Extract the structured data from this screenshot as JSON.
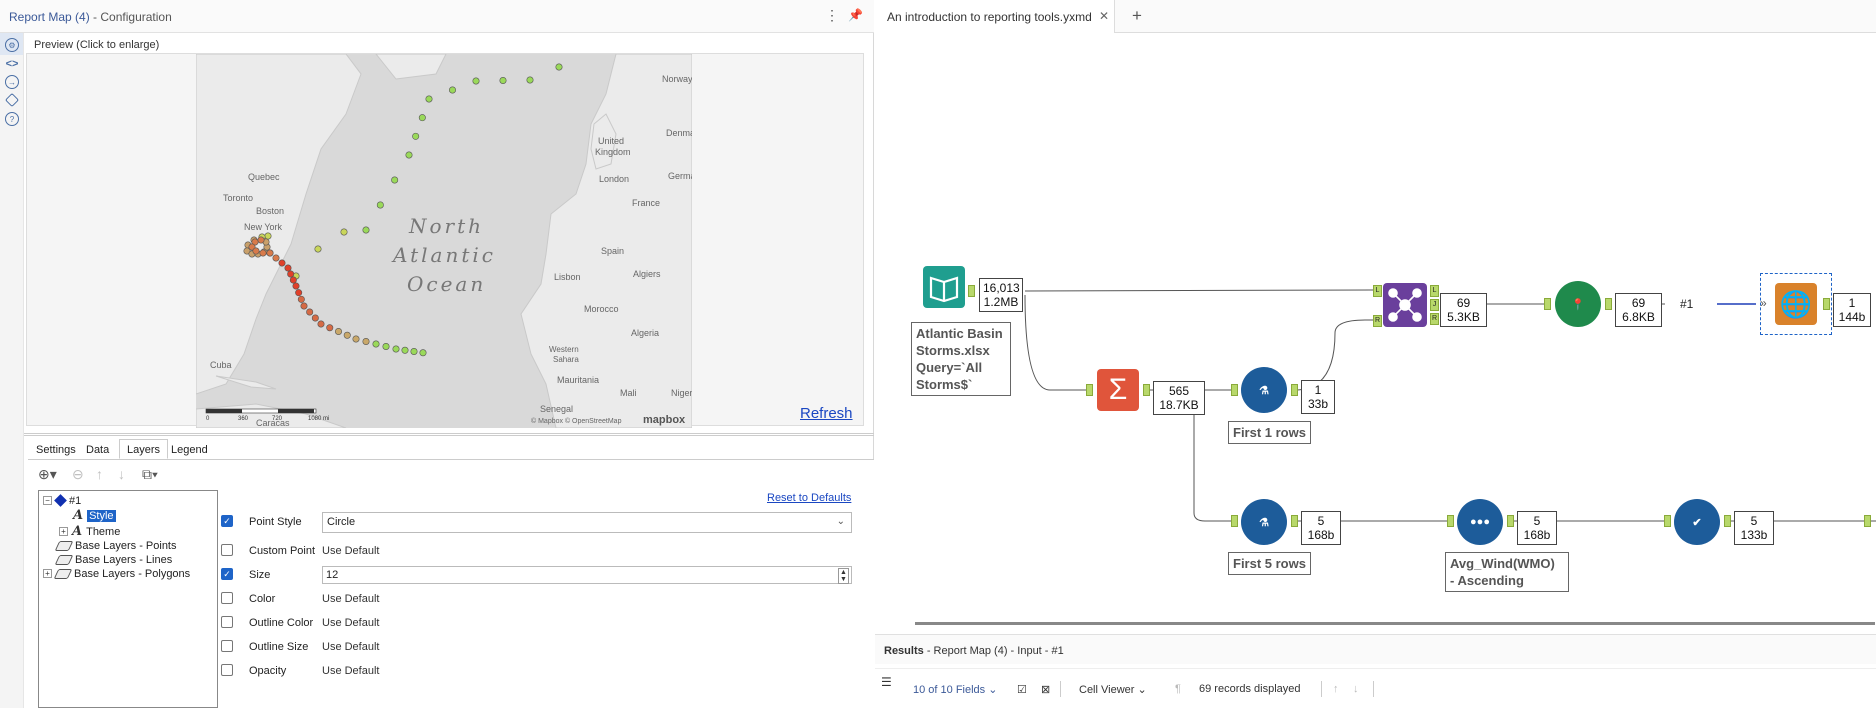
{
  "config": {
    "title": "Report Map (4)",
    "subtitle": "- Configuration",
    "preview_label": "Preview (Click to enlarge)",
    "refresh_label": "Refresh",
    "tabs": [
      "Settings",
      "Data",
      "Layers",
      "Legend"
    ],
    "active_tab": "Layers",
    "reset_label": "Reset to Defaults",
    "tree": {
      "root": "#1",
      "style": "Style",
      "theme": "Theme",
      "base_points": "Base Layers - Points",
      "base_lines": "Base Layers - Lines",
      "base_polygons": "Base Layers - Polygons"
    },
    "properties": [
      {
        "label": "Point Style",
        "checked": true,
        "value": "Circle"
      },
      {
        "label": "Custom Point",
        "checked": false,
        "value": "Use Default"
      },
      {
        "label": "Size",
        "checked": true,
        "value": "12"
      },
      {
        "label": "Color",
        "checked": false,
        "value": "Use Default"
      },
      {
        "label": "Outline Color",
        "checked": false,
        "value": "Use Default"
      },
      {
        "label": "Outline Size",
        "checked": false,
        "value": "Use Default"
      },
      {
        "label": "Opacity",
        "checked": false,
        "value": "Use Default"
      }
    ]
  },
  "map": {
    "ocean_label": [
      "North",
      "Atlantic",
      "Ocean"
    ],
    "places": [
      "Toronto",
      "Quebec",
      "Boston",
      "New York",
      "Cuba",
      "Caracas",
      "United Kingdom",
      "London",
      "France",
      "Spain",
      "Lisbon",
      "Algiers",
      "Morocco",
      "Algeria",
      "Western Sahara",
      "Mauritania",
      "Mali",
      "Niger",
      "Senegal",
      "Norway",
      "Denmark",
      "Germany"
    ],
    "scale_labels": [
      "0",
      "360",
      "720",
      "1080 mi"
    ],
    "attribution": "© Mapbox © OpenStreetMap",
    "logo": "mapbox"
  },
  "workflow": {
    "doc_tab": "An introduction to reporting tools.yxmd",
    "input_counts": [
      "16,013",
      "1.2MB"
    ],
    "input_annotation": [
      "Atlantic Basin",
      "Storms.xlsx",
      "Query=`All",
      "Storms$`"
    ],
    "summarize_counts": [
      "565",
      "18.7KB"
    ],
    "sample1_counts": [
      "1",
      "33b"
    ],
    "sample1_label": "First 1 rows",
    "join_anchors": [
      "L",
      "J",
      "R"
    ],
    "join_in_anchors": [
      "L",
      "R"
    ],
    "join_counts": [
      "69",
      "5.3KB"
    ],
    "map_counts": [
      "69",
      "6.8KB"
    ],
    "map_link_label": "#1",
    "render_counts": [
      "1",
      "144b"
    ],
    "sample5_counts": [
      "5",
      "168b"
    ],
    "sample5_label": "First 5 rows",
    "sort_counts": [
      "5",
      "168b"
    ],
    "sort_label": [
      "Avg_Wind(WMO)",
      "- Ascending"
    ],
    "select_counts": [
      "5",
      "133b"
    ]
  },
  "results": {
    "title": "Results",
    "subtitle": "- Report Map (4) - Input - #1",
    "fields_label": "10 of 10 Fields",
    "viewer_label": "Cell Viewer",
    "records_label": "69 records displayed"
  },
  "colors": {
    "accent": "#1e64c8",
    "input_tool": "#1f9e8f",
    "summarize_tool": "#e0553b",
    "sample_tool": "#1d5c9a",
    "join_tool": "#6a3f9c",
    "map_tool": "#1f8a4c",
    "render_tool": "#d9822b"
  }
}
